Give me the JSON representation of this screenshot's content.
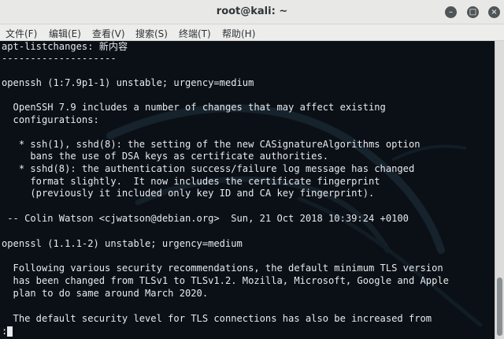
{
  "window": {
    "title": "root@kali: ~"
  },
  "controls": {
    "minimize": "–",
    "maximize": "□",
    "close": "×"
  },
  "menu": {
    "file": "文件(F)",
    "edit": "编辑(E)",
    "view": "查看(V)",
    "search": "搜索(S)",
    "terminal": "终端(T)",
    "help": "帮助(H)"
  },
  "terminal": {
    "lines": [
      "apt-listchanges: 新内容",
      "--------------------",
      "",
      "openssh (1:7.9p1-1) unstable; urgency=medium",
      "",
      "  OpenSSH 7.9 includes a number of changes that may affect existing",
      "  configurations:",
      "",
      "   * ssh(1), sshd(8): the setting of the new CASignatureAlgorithms option",
      "     bans the use of DSA keys as certificate authorities.",
      "   * sshd(8): the authentication success/failure log message has changed",
      "     format slightly.  It now includes the certificate fingerprint",
      "     (previously it included only key ID and CA key fingerprint).",
      "",
      " -- Colin Watson <cjwatson@debian.org>  Sun, 21 Oct 2018 10:39:24 +0100",
      "",
      "openssl (1.1.1-2) unstable; urgency=medium",
      "",
      "  Following various security recommendations, the default minimum TLS version",
      "  has been changed from TLSv1 to TLSv1.2. Mozilla, Microsoft, Google and Apple",
      "  plan to do same around March 2020.",
      "",
      "  The default security level for TLS connections has also be increased from"
    ],
    "prompt": ":"
  }
}
